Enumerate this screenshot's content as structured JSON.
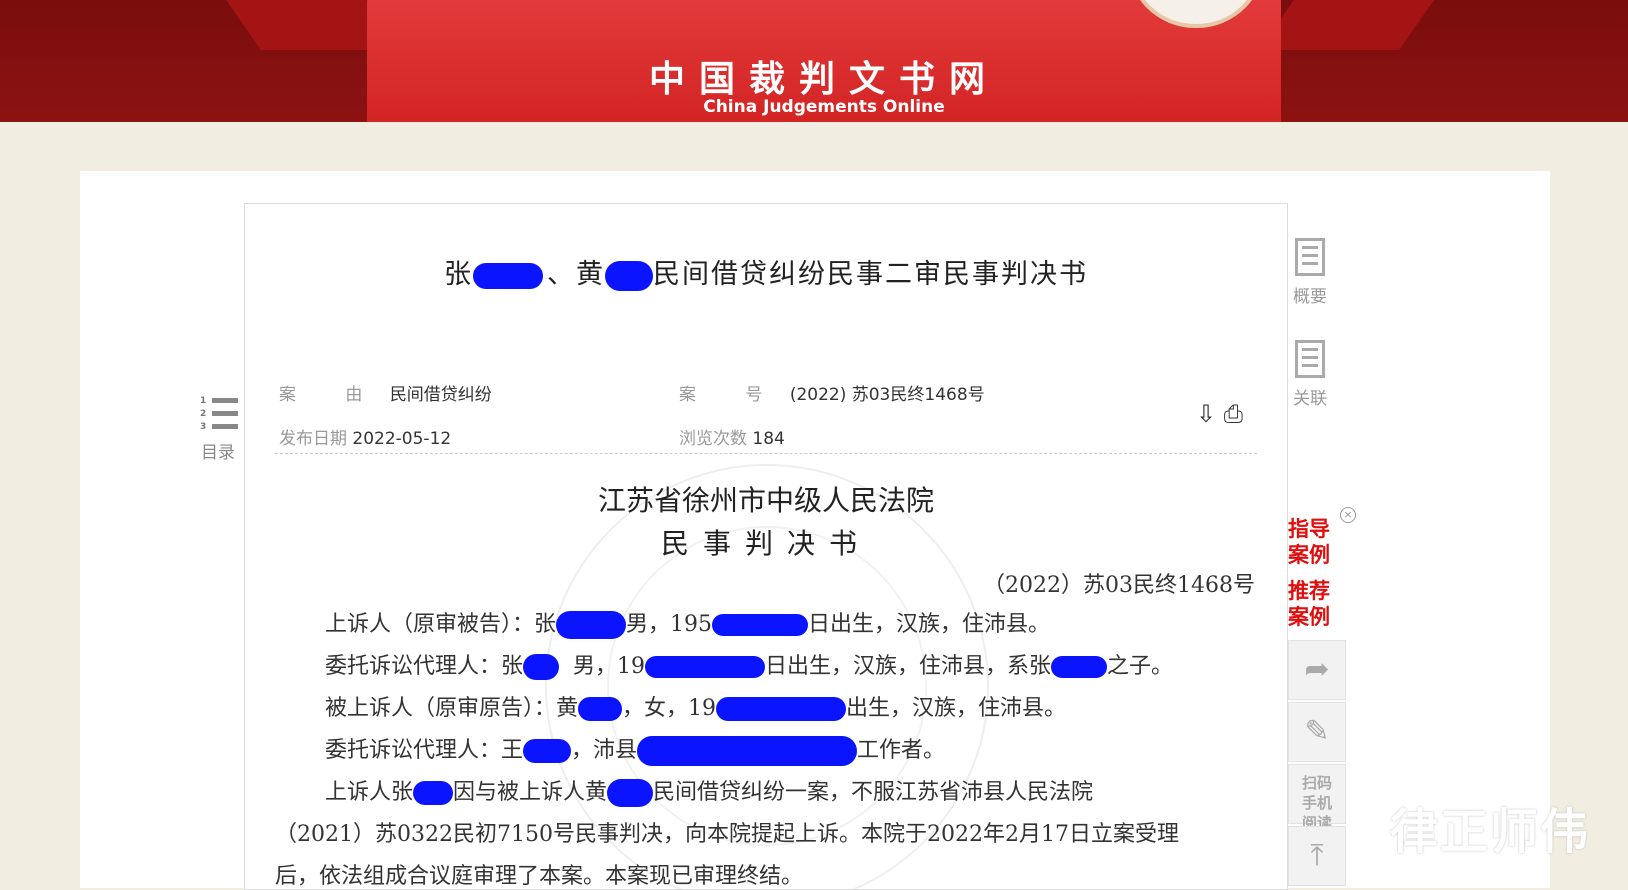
{
  "header": {
    "title_cn": "中国裁判文书网",
    "title_en": "China Judgements Online",
    "brand_color": "#d32424"
  },
  "document": {
    "title_parts": [
      "张",
      "、黄",
      "民间借贷纠纷民事二审民事判决书"
    ],
    "meta": {
      "cause_label": "案 由",
      "cause_value": "民间借贷纠纷",
      "case_no_label": "案 号",
      "case_no_value": "(2022) 苏03民终1468号",
      "publish_label": "发布日期",
      "publish_value": "2022-05-12",
      "views_label": "浏览次数",
      "views_value": "184"
    },
    "court": "江苏省徐州市中级人民法院",
    "doc_type": "民事判决书",
    "case_number": "（2022）苏03民终1468号",
    "paragraphs": [
      {
        "a": "上诉人（原审被告）：张",
        "b": "男，195",
        "c": "日出生，汉族，住沛县。"
      },
      {
        "a": "委托诉讼代理人：张",
        "b": "男，19",
        "c": "日出生，汉族，住沛县，系张",
        "d": "之子。"
      },
      {
        "a": "被上诉人（原审原告）：黄",
        "b": "，女，19",
        "c": "出生，汉族，住沛县。"
      },
      {
        "a": "委托诉讼代理人：王",
        "b": "，沛县",
        "c": "工作者。"
      },
      {
        "a": "上诉人张",
        "b": "因与被上诉人黄",
        "c": "民间借贷纠纷一案，不服江苏省沛县人民法院"
      },
      {
        "a": "（2021）苏0322民初7150号民事判决，向本院提起上诉。本院于2022年2月17日立案受理"
      },
      {
        "a": "后，依法组成合议庭审理了本案。本案现已审理终结。"
      }
    ]
  },
  "toc": {
    "label": "目录",
    "numbers": [
      "1",
      "2",
      "3"
    ]
  },
  "side": {
    "summary_label": "概要",
    "related_label": "关联",
    "guide_cases": "指导案例",
    "recommended_cases": "推荐案例",
    "close_symbol": "×",
    "scan_label": "扫码手机阅读",
    "icons": [
      "share-icon",
      "edit-icon",
      "back-to-top-icon"
    ]
  },
  "watermark_logo": "律正师伟",
  "colors": {
    "redaction": "#0a14ff",
    "link_red": "#e00e0e"
  }
}
